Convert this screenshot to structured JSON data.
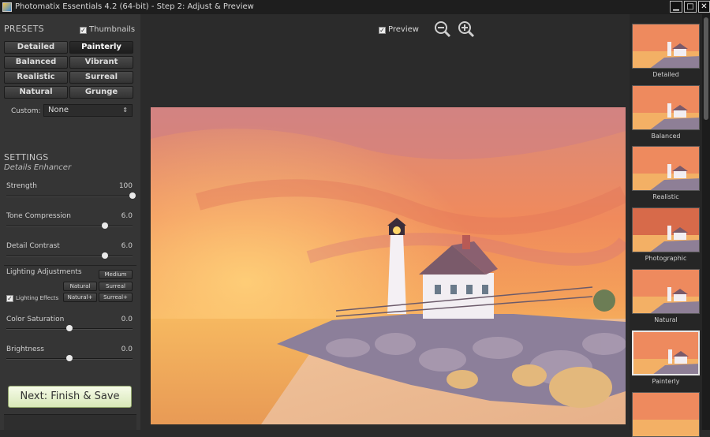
{
  "window": {
    "title": "Photomatix Essentials 4.2 (64-bit) - Step 2: Adjust & Preview",
    "minimize": "▁",
    "maximize": "□",
    "close": "✕"
  },
  "presets": {
    "heading": "PRESETS",
    "thumbnails_label": "Thumbnails",
    "buttons": [
      "Detailed",
      "Painterly",
      "Balanced",
      "Vibrant",
      "Realistic",
      "Surreal",
      "Natural",
      "Grunge"
    ],
    "selected": "Painterly",
    "custom_label": "Custom:",
    "custom_value": "None"
  },
  "settings": {
    "heading": "SETTINGS",
    "subheading": "Details Enhancer",
    "sliders": [
      {
        "label": "Strength",
        "value": "100",
        "level": 1.0
      },
      {
        "label": "Tone Compression",
        "value": "6.0",
        "level": 0.78
      },
      {
        "label": "Detail Contrast",
        "value": "6.0",
        "level": 0.78
      }
    ],
    "lighting": {
      "label": "Lighting Adjustments",
      "medium": "Medium",
      "natural": "Natural",
      "surreal": "Surreal",
      "natural_plus": "Natural+",
      "surreal_plus": "Surreal+",
      "effects_label": "Lighting Effects"
    },
    "sliders2": [
      {
        "label": "Color Saturation",
        "value": "0.0",
        "level": 0.5
      },
      {
        "label": "Brightness",
        "value": "0.0",
        "level": 0.5
      }
    ]
  },
  "next_button": "Next: Finish & Save",
  "toolbar": {
    "preview_label": "Preview",
    "zoom_out": "zoom-out-icon",
    "zoom_in": "zoom-in-icon"
  },
  "thumbnails": [
    "Detailed",
    "Balanced",
    "Realistic",
    "Photographic",
    "Natural",
    "Painterly"
  ],
  "selected_thumbnail": "Painterly"
}
